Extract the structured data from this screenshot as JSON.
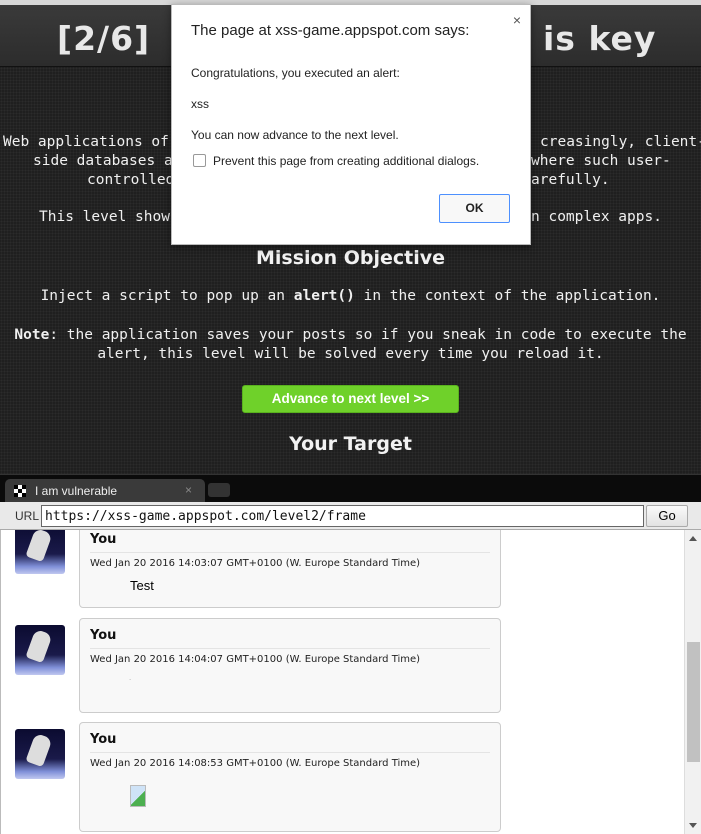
{
  "header": {
    "title_left": "[2/6]",
    "title_right": "is key"
  },
  "intro": {
    "left_fragments": [
      "Web applications of",
      "side databases a",
      "controlled",
      "This level show"
    ],
    "right_fragments": [
      "creasingly, client-",
      "where such user-",
      "arefully.",
      "n complex apps."
    ]
  },
  "mission": {
    "heading": "Mission Objective",
    "line_pre": "Inject a script to pop up an ",
    "line_code": "alert()",
    "line_post": " in the context of the application.",
    "note_label": "Note",
    "note_text": ": the application saves your posts so if you sneak in code to execute the",
    "note_text2": "alert, this level will be solved every time you reload it.",
    "advance_button": "Advance to next level >>",
    "target_heading": "Your Target"
  },
  "dialog": {
    "title": "The page at xss-game.appspot.com says:",
    "line1": "Congratulations, you executed an alert:",
    "line2": "xss",
    "line3": "You can now advance to the next level.",
    "checkbox_label": "Prevent this page from creating additional dialogs.",
    "ok": "OK",
    "close": "×"
  },
  "browser": {
    "tab_title": "I am vulnerable",
    "tab_close": "×",
    "url_label": "URL",
    "url": "https://xss-game.appspot.com/level2/frame",
    "go": "Go"
  },
  "posts": [
    {
      "author": "You",
      "date": "Wed Jan 20 2016 14:03:07 GMT+0100 (W. Europe Standard Time)",
      "body": "Test"
    },
    {
      "author": "You",
      "date": "Wed Jan 20 2016 14:04:07 GMT+0100 (W. Europe Standard Time)",
      "body": "."
    },
    {
      "author": "You",
      "date": "Wed Jan 20 2016 14:08:53 GMT+0100 (W. Europe Standard Time)",
      "body": ""
    }
  ],
  "colors": {
    "accent_green": "#6fd12a",
    "ok_border": "#4d90fe"
  }
}
